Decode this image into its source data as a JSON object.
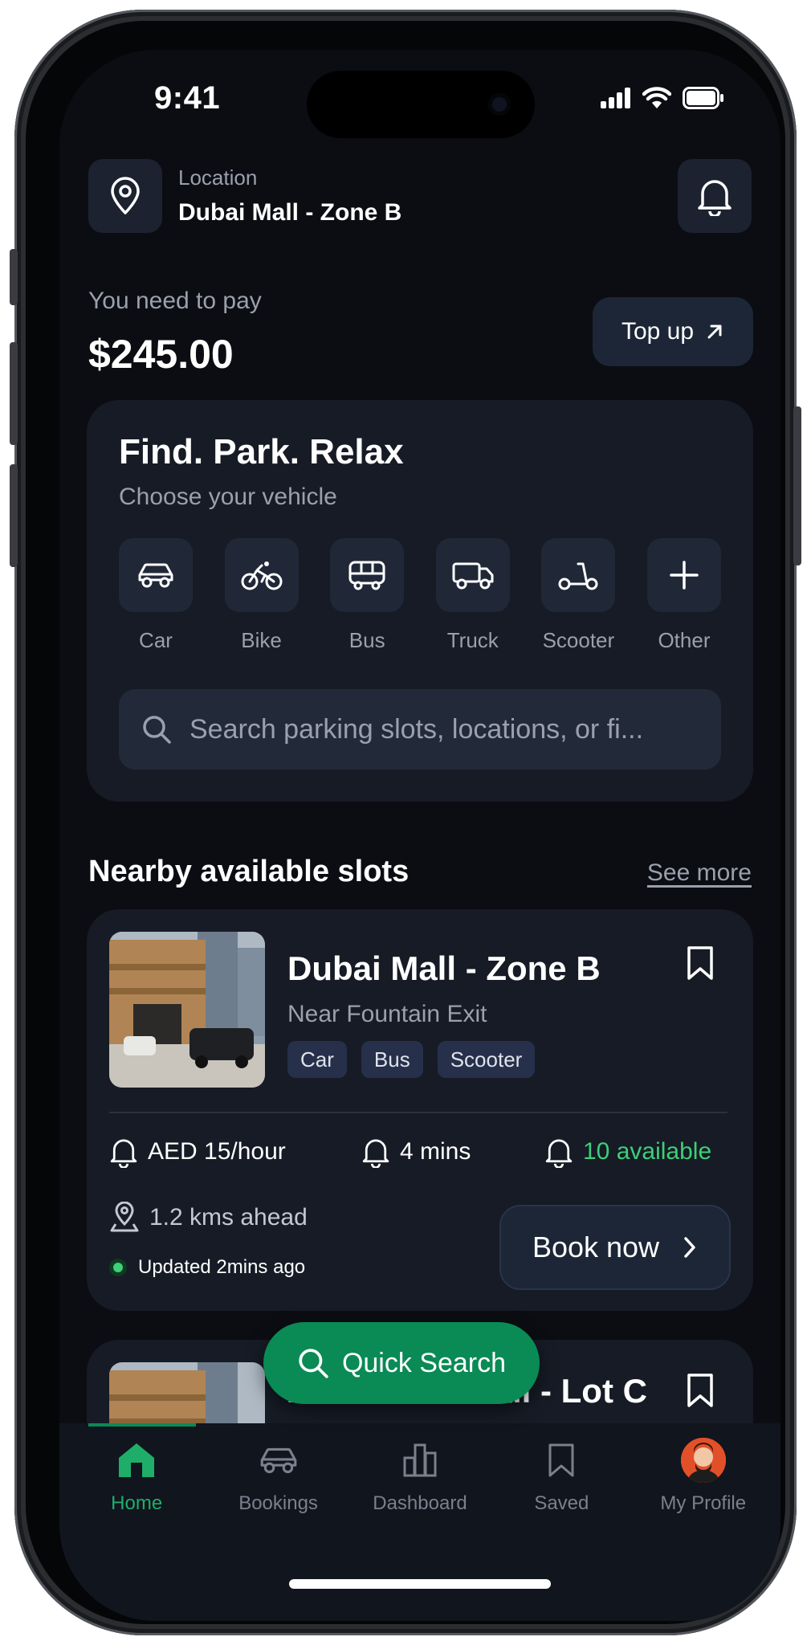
{
  "status_bar": {
    "time": "9:41"
  },
  "header": {
    "location_label": "Location",
    "location_value": "Dubai Mall - Zone B",
    "location_icon": "map-pin-icon",
    "notification_icon": "bell-icon"
  },
  "payment": {
    "label": "You need to pay",
    "amount": "$245.00",
    "topup_label": "Top up"
  },
  "find_card": {
    "title": "Find. Park. Relax",
    "subtitle": "Choose your vehicle",
    "vehicles": [
      {
        "label": "Car",
        "icon": "car-icon"
      },
      {
        "label": "Bike",
        "icon": "bike-icon"
      },
      {
        "label": "Bus",
        "icon": "bus-icon"
      },
      {
        "label": "Truck",
        "icon": "truck-icon"
      },
      {
        "label": "Scooter",
        "icon": "scooter-icon"
      },
      {
        "label": "Other",
        "icon": "plus-icon"
      }
    ],
    "search_placeholder": "Search parking slots, locations, or fi..."
  },
  "nearby": {
    "title": "Nearby available slots",
    "see_more": "See more",
    "slots": [
      {
        "name": "Dubai Mall - Zone B",
        "subtitle": "Near Fountain Exit",
        "tags": [
          "Car",
          "Bus",
          "Scooter"
        ],
        "rate": "AED 15/hour",
        "time": "4 mins",
        "availability": "10 available",
        "distance": "1.2 kms ahead",
        "updated": "Updated 2mins ago",
        "book_label": "Book now"
      },
      {
        "name": "Abu Dhabi Mall - Lot C"
      }
    ]
  },
  "quick_search_label": "Quick Search",
  "nav": {
    "items": [
      {
        "label": "Home",
        "icon": "home-icon",
        "active": true
      },
      {
        "label": "Bookings",
        "icon": "car-icon"
      },
      {
        "label": "Dashboard",
        "icon": "bar-chart-icon"
      },
      {
        "label": "Saved",
        "icon": "bookmark-icon"
      },
      {
        "label": "My Profile",
        "icon": "avatar"
      }
    ]
  },
  "colors": {
    "background": "#0b0d12",
    "card": "#161b25",
    "accent_green": "#0a8a55",
    "available_green": "#3ecf78",
    "muted_text": "#9aa0ac"
  }
}
